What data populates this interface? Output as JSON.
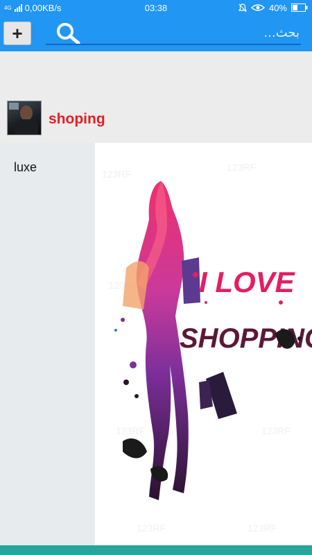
{
  "status_bar": {
    "network": "4G",
    "speed": "0,00KB/s",
    "time": "03:38",
    "battery": "40%"
  },
  "toolbar": {
    "add_label": "+",
    "search_placeholder": "بحث..."
  },
  "post": {
    "username": "shoping",
    "category": "luxe",
    "image_text_line1": "I LOVE",
    "image_text_line2": "SHOPPING",
    "watermark": "123RF"
  },
  "colors": {
    "primary": "#2196f3",
    "username": "#e31e24",
    "bottom_bar": "#26a69a"
  }
}
